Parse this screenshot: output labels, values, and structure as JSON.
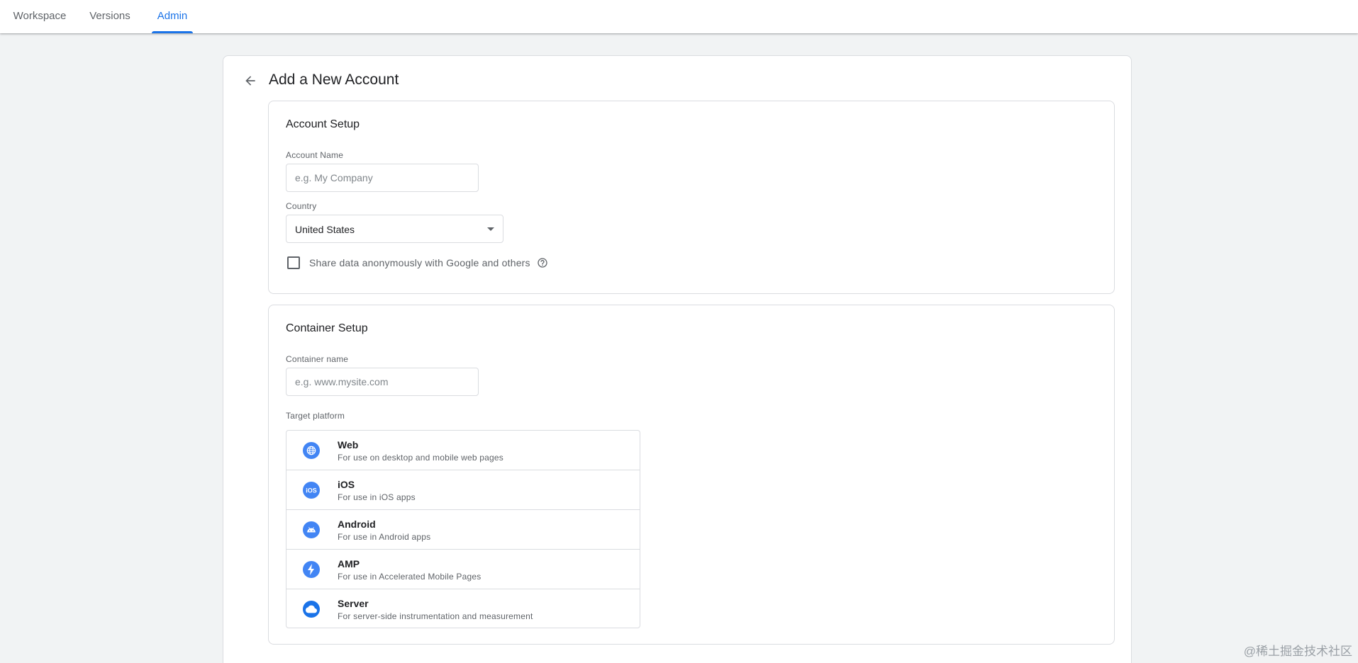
{
  "nav": {
    "tabs": [
      {
        "label": "Workspace"
      },
      {
        "label": "Versions"
      },
      {
        "label": "Admin",
        "active": true
      }
    ]
  },
  "page": {
    "title": "Add a New Account"
  },
  "account_setup": {
    "title": "Account Setup",
    "account_name_label": "Account Name",
    "account_name_placeholder": "e.g. My Company",
    "account_name_value": "",
    "country_label": "Country",
    "country_value": "United States",
    "share_label": "Share data anonymously with Google and others",
    "share_checked": false
  },
  "container_setup": {
    "title": "Container Setup",
    "container_name_label": "Container name",
    "container_name_placeholder": "e.g. www.mysite.com",
    "container_name_value": "",
    "target_platform_label": "Target platform",
    "platforms": [
      {
        "name": "Web",
        "desc": "For use on desktop and mobile web pages",
        "icon": "globe-icon"
      },
      {
        "name": "iOS",
        "desc": "For use in iOS apps",
        "icon": "ios-icon"
      },
      {
        "name": "Android",
        "desc": "For use in Android apps",
        "icon": "android-icon"
      },
      {
        "name": "AMP",
        "desc": "For use in Accelerated Mobile Pages",
        "icon": "amp-bolt-icon"
      },
      {
        "name": "Server",
        "desc": "For server-side instrumentation and measurement",
        "icon": "cloud-icon"
      }
    ]
  },
  "colors": {
    "accent": "#1a73e8",
    "icon_blue": "#4285f4",
    "border": "#dadce0",
    "background": "#f1f3f4"
  },
  "watermark": "@稀土掘金技术社区"
}
